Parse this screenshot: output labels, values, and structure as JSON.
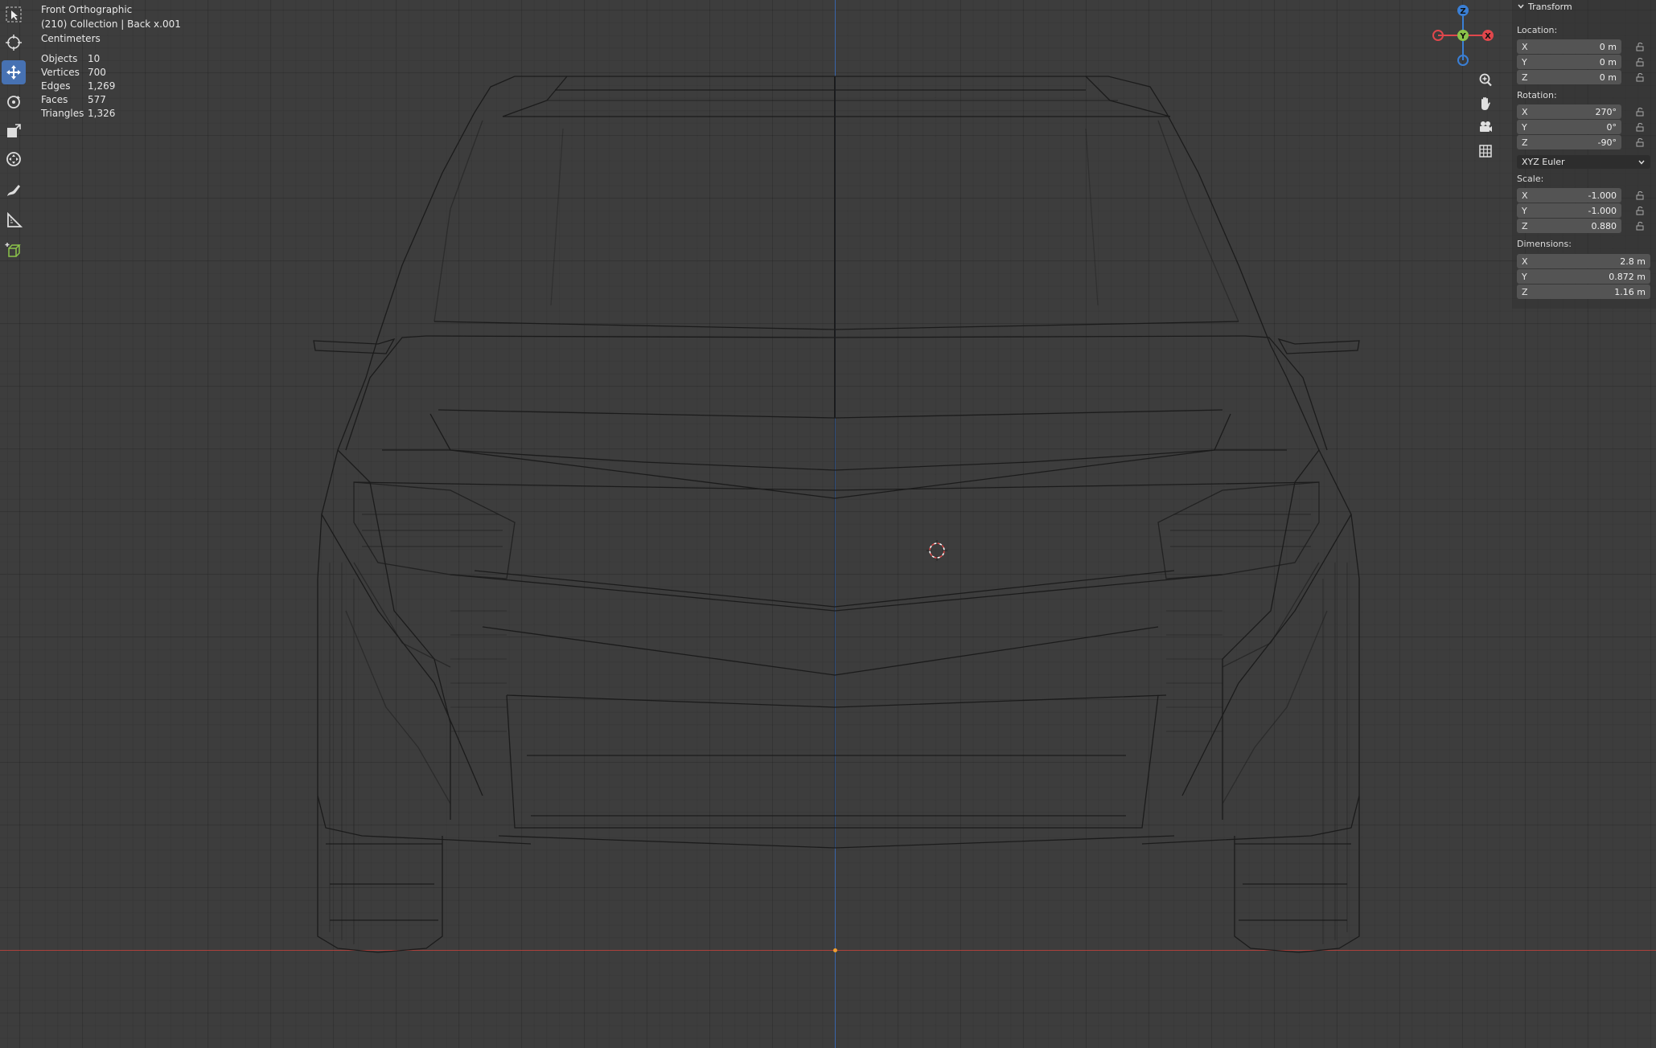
{
  "viewport": {
    "view_name": "Front Orthographic",
    "collection_line": "(210) Collection | Back x.001",
    "units": "Centimeters"
  },
  "stats": [
    {
      "label": "Objects",
      "value": "10"
    },
    {
      "label": "Vertices",
      "value": "700"
    },
    {
      "label": "Edges",
      "value": "1,269"
    },
    {
      "label": "Faces",
      "value": "577"
    },
    {
      "label": "Triangles",
      "value": "1,326"
    }
  ],
  "toolbar": {
    "tools": [
      "select-box-icon",
      "cursor-icon",
      "move-icon",
      "rotate-icon",
      "scale-icon",
      "transform-icon",
      "annotate-icon",
      "measure-icon",
      "add-cube-icon"
    ],
    "active_tool": "move-icon"
  },
  "gizmo": {
    "z": "Z",
    "y": "Y",
    "x": "X"
  },
  "transform": {
    "header": "Transform",
    "location_label": "Location:",
    "location": [
      {
        "axis": "X",
        "value": "0 m"
      },
      {
        "axis": "Y",
        "value": "0 m"
      },
      {
        "axis": "Z",
        "value": "0 m"
      }
    ],
    "rotation_label": "Rotation:",
    "rotation": [
      {
        "axis": "X",
        "value": "270°"
      },
      {
        "axis": "Y",
        "value": "0°"
      },
      {
        "axis": "Z",
        "value": "-90°"
      }
    ],
    "rotation_mode": "XYZ Euler",
    "scale_label": "Scale:",
    "scale": [
      {
        "axis": "X",
        "value": "-1.000"
      },
      {
        "axis": "Y",
        "value": "-1.000"
      },
      {
        "axis": "Z",
        "value": "0.880"
      }
    ],
    "dimensions_label": "Dimensions:",
    "dimensions": [
      {
        "axis": "X",
        "value": "2.8 m"
      },
      {
        "axis": "Y",
        "value": "0.872 m"
      },
      {
        "axis": "Z",
        "value": "1.16 m"
      }
    ]
  },
  "colors": {
    "accent": "#4772b3",
    "axis_x": "#b8433d",
    "axis_z": "#3b6fbf",
    "gizmo_x": "#e0474c",
    "gizmo_y": "#8bc34a",
    "gizmo_z": "#3a7fd5"
  }
}
